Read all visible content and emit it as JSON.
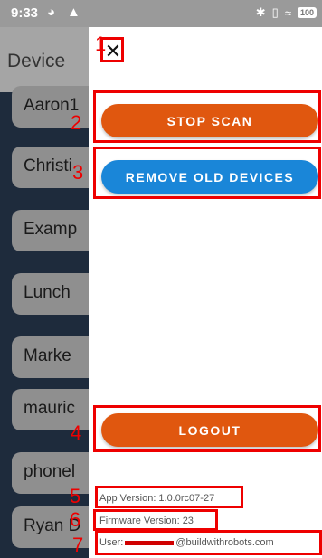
{
  "status_bar": {
    "time": "9:33",
    "left_icons": [
      "vpn-icon",
      "warning-icon"
    ],
    "right_icons": [
      "bluetooth-icon",
      "vibrate-icon",
      "wifi-icon"
    ],
    "battery": "100"
  },
  "background": {
    "title": "Device",
    "items": [
      "Aaron1",
      "Christi",
      "Examp",
      "Lunch",
      "Marke",
      "mauric",
      "phonel",
      "Ryan D"
    ]
  },
  "panel": {
    "close_label": "✕",
    "stop_scan_label": "STOP SCAN",
    "remove_old_label": "REMOVE OLD DEVICES",
    "logout_label": "LOGOUT",
    "app_version": "App Version: 1.0.0rc07-27",
    "firmware_version": "Firmware Version: 23",
    "user_prefix": "User:",
    "user_suffix": "@buildwithrobots.com"
  },
  "annotations": [
    "1",
    "2",
    "3",
    "4",
    "5",
    "6",
    "7"
  ],
  "colors": {
    "orange": "#e0570f",
    "blue": "#1a86d8",
    "annotation": "#ee0000"
  }
}
